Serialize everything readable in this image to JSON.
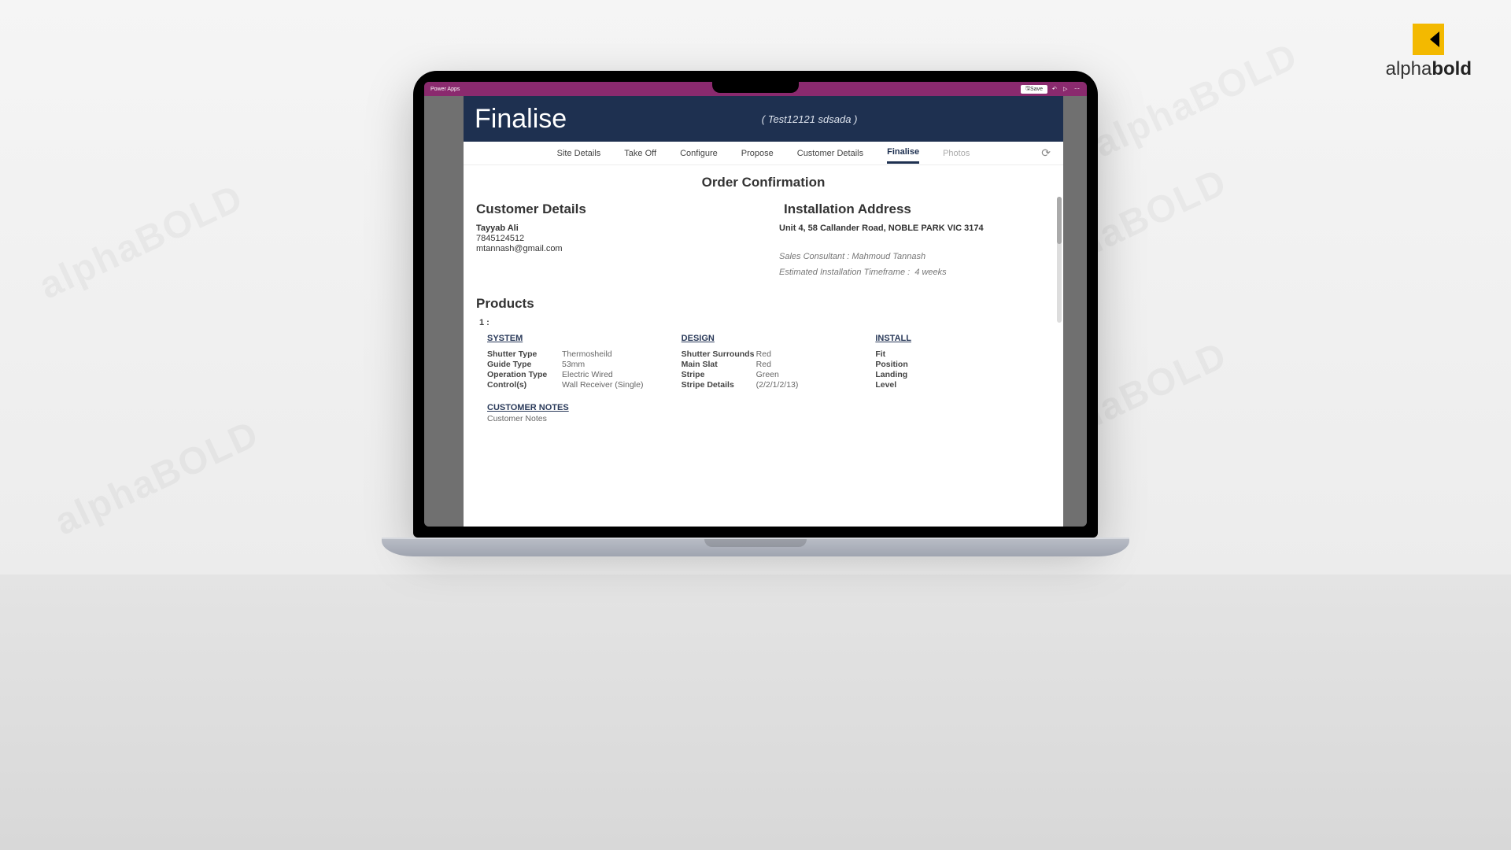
{
  "brand": {
    "name_a": "alpha",
    "name_b": "bold"
  },
  "watermark": "alphaBOLD",
  "appbar": {
    "product": "Power Apps",
    "save": "Save"
  },
  "header": {
    "title": "Finalise",
    "subtitle": "( Test12121 sdsada )"
  },
  "tabs": [
    {
      "label": "Site Details"
    },
    {
      "label": "Take Off"
    },
    {
      "label": "Configure"
    },
    {
      "label": "Propose"
    },
    {
      "label": "Customer Details"
    },
    {
      "label": "Finalise",
      "active": true
    },
    {
      "label": "Photos",
      "muted": true
    }
  ],
  "content": {
    "page_title": "Order Confirmation",
    "customer": {
      "heading": "Customer Details",
      "name": "Tayyab Ali",
      "phone": "7845124512",
      "email": "mtannash@gmail.com"
    },
    "install": {
      "heading": "Installation Address",
      "address": "Unit 4, 58 Callander Road, NOBLE PARK VIC 3174",
      "consultant_label": "Sales Consultant :",
      "consultant_value": "Mahmoud Tannash",
      "timeframe_label": "Estimated Installation Timeframe :",
      "timeframe_value": "4  weeks"
    },
    "products": {
      "heading": "Products",
      "index": "1   :",
      "system": {
        "heading": "SYSTEM",
        "rows": [
          {
            "k": "Shutter Type",
            "v": "Thermosheild"
          },
          {
            "k": "Guide Type",
            "v": "53mm"
          },
          {
            "k": "Operation Type",
            "v": "Electric Wired"
          },
          {
            "k": "Control(s)",
            "v": "Wall Receiver (Single)"
          }
        ]
      },
      "design": {
        "heading": "DESIGN",
        "rows": [
          {
            "k": "Shutter Surrounds",
            "v": "Red"
          },
          {
            "k": "Main Slat",
            "v": "Red"
          },
          {
            "k": "Stripe",
            "v": "Green"
          },
          {
            "k": "Stripe Details",
            "v": "(2/2/1/2/13)"
          }
        ]
      },
      "install_spec": {
        "heading": "INSTALL",
        "rows": [
          {
            "k": "Fit",
            "v": ""
          },
          {
            "k": "Position",
            "v": ""
          },
          {
            "k": "Landing",
            "v": ""
          },
          {
            "k": "Level",
            "v": ""
          }
        ]
      },
      "notes": {
        "heading": "CUSTOMER NOTES",
        "text": "Customer Notes"
      }
    }
  }
}
